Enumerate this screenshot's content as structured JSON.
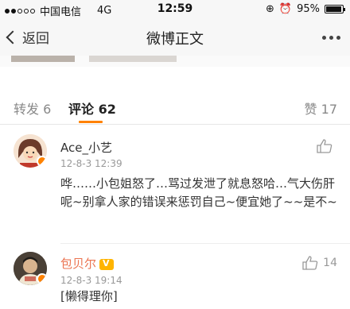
{
  "status": {
    "carrier": "中国电信",
    "network": "4G",
    "time": "12:59",
    "battery": "95%"
  },
  "nav": {
    "back_label": "返回",
    "title": "微博正文"
  },
  "tabs": {
    "repost_label": "转发",
    "repost_count": "6",
    "comment_label": "评论",
    "comment_count": "62",
    "like_label": "赞",
    "like_count": "17"
  },
  "comments": [
    {
      "user": "Ace_小艺",
      "time": "12-8-3 12:39",
      "likes": "",
      "text": "哗……小包姐怒了…骂过发泄了就息怒哈…气大伤肝呢~别拿人家的错误来惩罚自己~便宜她了~~是不~"
    },
    {
      "user": "包贝尔",
      "time": "12-8-3 19:14",
      "likes": "14",
      "text": "[懒得理你]"
    }
  ],
  "colors": {
    "accent": "#ff8200",
    "username_orange": "#eb7350"
  }
}
